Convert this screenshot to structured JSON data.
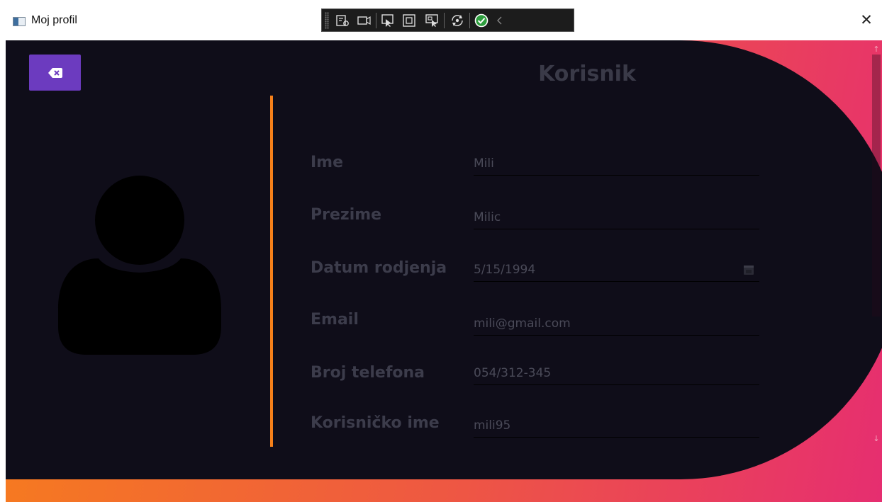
{
  "window": {
    "title": "Moj profil",
    "close_glyph": "✕",
    "app_icon": "window-app-icon"
  },
  "debug_toolbar": {
    "icons": [
      "live-visual-tree-icon",
      "record-icon",
      "select-element-icon",
      "layout-adorners-icon",
      "track-focus-icon",
      "hot-reload-icon",
      "binding-ok-icon",
      "collapse-chevron-icon"
    ]
  },
  "back_button": {
    "icon": "backspace-x-icon"
  },
  "avatar": {
    "icon": "user-silhouette-icon"
  },
  "page": {
    "title": "Korisnik"
  },
  "form": {
    "fields": [
      {
        "label": "Ime",
        "value": "Mili"
      },
      {
        "label": "Prezime",
        "value": "Milic"
      },
      {
        "label": "Datum rodjenja",
        "value": "5/15/1994",
        "icon": "calendar-icon"
      },
      {
        "label": "Email",
        "value": "mili@gmail.com"
      },
      {
        "label": "Broj telefona",
        "value": "054/312-345"
      },
      {
        "label": "Korisničko ime",
        "value": "mili95"
      }
    ]
  },
  "colors": {
    "panel": "#0f0d19",
    "accent_orange": "#f5801a",
    "gradient_start": "#f77f1b",
    "gradient_end": "#e62e70",
    "button_purple": "#6c3bbf",
    "label_text": "#3c3c4b"
  }
}
